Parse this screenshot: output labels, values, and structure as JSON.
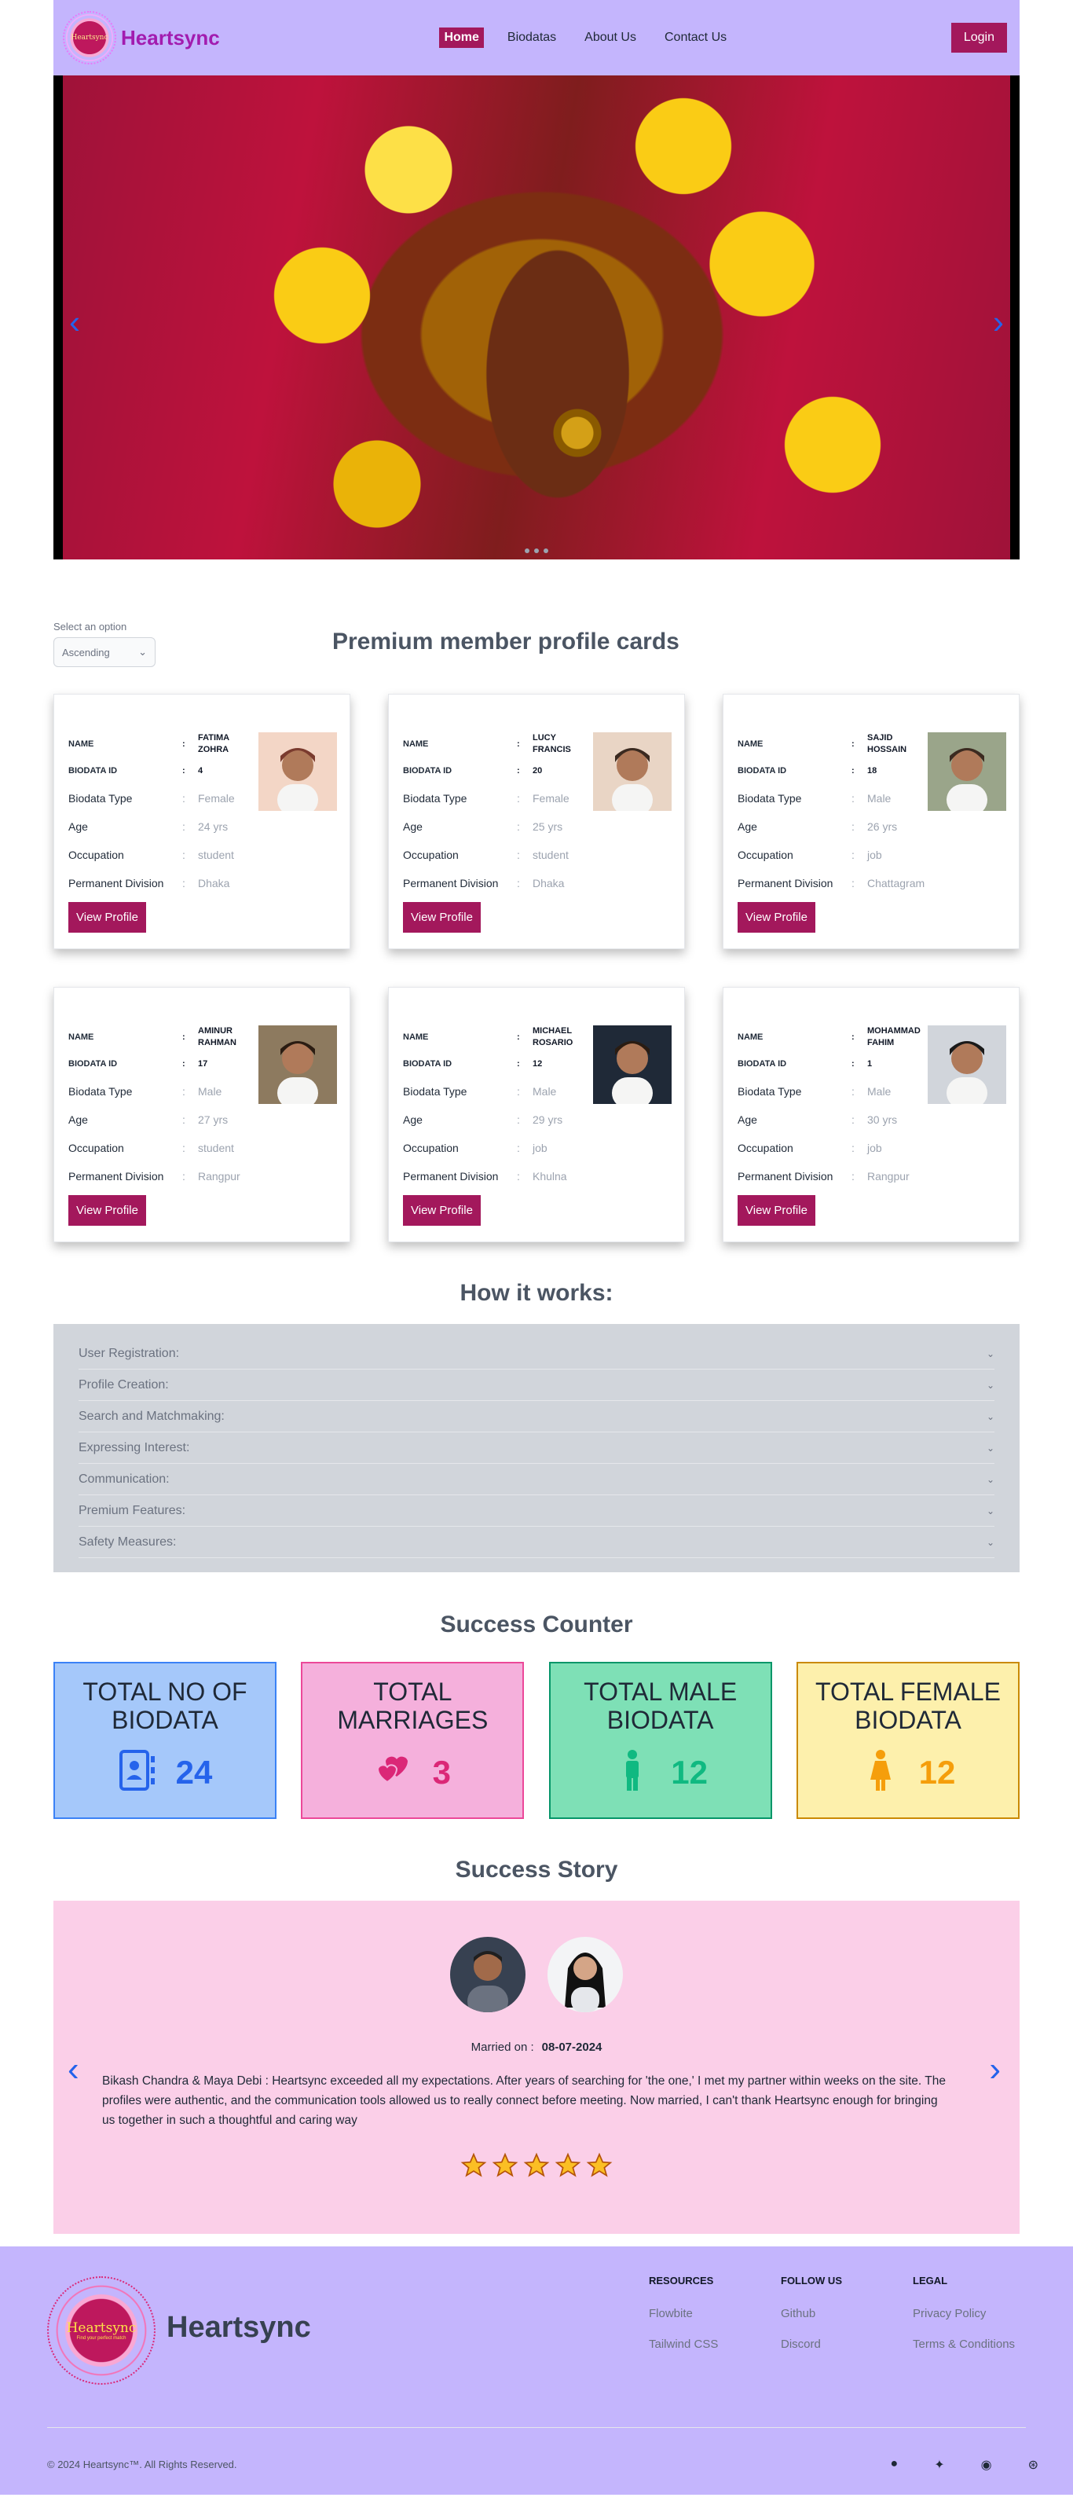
{
  "nav": {
    "logo_text": "Heartsync",
    "brand": "Heartsync",
    "links": [
      "Home",
      "Biodatas",
      "About Us",
      "Contact Us"
    ],
    "login": "Login"
  },
  "hero": {
    "prev": "‹",
    "next": "›"
  },
  "premium": {
    "select_label": "Select an option",
    "select_value": "Ascending",
    "title": "Premium member profile cards",
    "labels": {
      "name": "NAME",
      "id": "BIODATA ID",
      "type": "Biodata Type",
      "age": "Age",
      "occupation": "Occupation",
      "division": "Permanent Division"
    },
    "view_label": "View Profile",
    "cards": [
      {
        "name": "FATIMA ZOHRA",
        "id": "4",
        "type": "Female",
        "age": "24 yrs",
        "occupation": "student",
        "division": "Dhaka"
      },
      {
        "name": "LUCY FRANCIS",
        "id": "20",
        "type": "Female",
        "age": "25 yrs",
        "occupation": "student",
        "division": "Dhaka"
      },
      {
        "name": "SAJID HOSSAIN",
        "id": "18",
        "type": "Male",
        "age": "26 yrs",
        "occupation": "job",
        "division": "Chattagram"
      },
      {
        "name": "AMINUR RAHMAN",
        "id": "17",
        "type": "Male",
        "age": "27 yrs",
        "occupation": "student",
        "division": "Rangpur"
      },
      {
        "name": "MICHAEL ROSARIO",
        "id": "12",
        "type": "Male",
        "age": "29 yrs",
        "occupation": "job",
        "division": "Khulna"
      },
      {
        "name": "MOHAMMAD FAHIM",
        "id": "1",
        "type": "Male",
        "age": "30 yrs",
        "occupation": "job",
        "division": "Rangpur"
      }
    ]
  },
  "how": {
    "title": "How it works:",
    "items": [
      "User Registration:",
      "Profile Creation:",
      "Search and Matchmaking:",
      "Expressing Interest:",
      "Communication:",
      "Premium Features:",
      "Safety Measures:"
    ]
  },
  "counter": {
    "title": "Success Counter",
    "items": [
      {
        "label": "TOTAL NO OF BIODATA",
        "value": "24",
        "color": "#2563eb",
        "bg": "#a5c8fa",
        "border": "#3b82f6"
      },
      {
        "label": "TOTAL MARRIAGES",
        "value": "3",
        "color": "#db2777",
        "bg": "#f5b0dc",
        "border": "#ec4899"
      },
      {
        "label": "TOTAL MALE BIODATA",
        "value": "12",
        "color": "#10b981",
        "bg": "#7ee0b6",
        "border": "#059669"
      },
      {
        "label": "TOTAL FEMALE BIODATA",
        "value": "12",
        "color": "#f59e0b",
        "bg": "#fdf0ac",
        "border": "#ca8a04"
      }
    ]
  },
  "story": {
    "title": "Success Story",
    "married_label": "Married on :",
    "date": "08-07-2024",
    "text": "Bikash Chandra & Maya Debi : Heartsync exceeded all my expectations. After years of searching for 'the one,' I met my partner within weeks on the site. The profiles were authentic, and the communication tools allowed us to really connect before meeting. Now married, I can't thank Heartsync enough for bringing us together in such a thoughtful and caring way",
    "rating": 5
  },
  "footer": {
    "logo_text": "Heartsync",
    "logo_sub": "Find your perfect match",
    "brand": "Heartsync",
    "cols": [
      {
        "title": "RESOURCES",
        "links": [
          "Flowbite",
          "Tailwind CSS"
        ]
      },
      {
        "title": "FOLLOW US",
        "links": [
          "Github",
          "Discord"
        ]
      },
      {
        "title": "LEGAL",
        "links": [
          "Privacy Policy",
          "Terms & Conditions"
        ]
      }
    ],
    "copyright": "© 2024 Heartsync™. All Rights Reserved."
  }
}
